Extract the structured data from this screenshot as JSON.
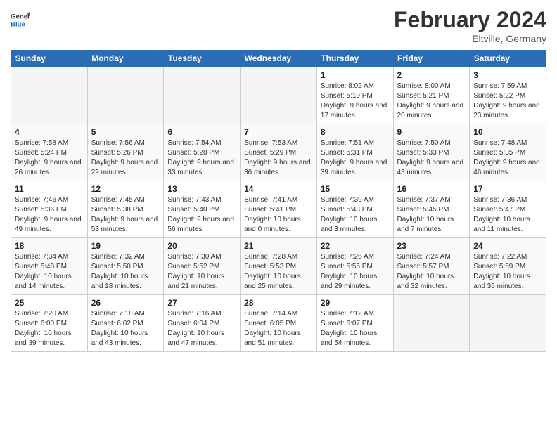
{
  "header": {
    "logo_general": "General",
    "logo_blue": "Blue",
    "month_title": "February 2024",
    "location": "Eltville, Germany"
  },
  "calendar": {
    "days_of_week": [
      "Sunday",
      "Monday",
      "Tuesday",
      "Wednesday",
      "Thursday",
      "Friday",
      "Saturday"
    ],
    "weeks": [
      [
        {
          "day": "",
          "sunrise": "",
          "sunset": "",
          "daylight": "",
          "empty": true
        },
        {
          "day": "",
          "sunrise": "",
          "sunset": "",
          "daylight": "",
          "empty": true
        },
        {
          "day": "",
          "sunrise": "",
          "sunset": "",
          "daylight": "",
          "empty": true
        },
        {
          "day": "",
          "sunrise": "",
          "sunset": "",
          "daylight": "",
          "empty": true
        },
        {
          "day": "1",
          "sunrise": "Sunrise: 8:02 AM",
          "sunset": "Sunset: 5:19 PM",
          "daylight": "Daylight: 9 hours and 17 minutes.",
          "empty": false
        },
        {
          "day": "2",
          "sunrise": "Sunrise: 8:00 AM",
          "sunset": "Sunset: 5:21 PM",
          "daylight": "Daylight: 9 hours and 20 minutes.",
          "empty": false
        },
        {
          "day": "3",
          "sunrise": "Sunrise: 7:59 AM",
          "sunset": "Sunset: 5:22 PM",
          "daylight": "Daylight: 9 hours and 23 minutes.",
          "empty": false
        }
      ],
      [
        {
          "day": "4",
          "sunrise": "Sunrise: 7:58 AM",
          "sunset": "Sunset: 5:24 PM",
          "daylight": "Daylight: 9 hours and 26 minutes.",
          "empty": false
        },
        {
          "day": "5",
          "sunrise": "Sunrise: 7:56 AM",
          "sunset": "Sunset: 5:26 PM",
          "daylight": "Daylight: 9 hours and 29 minutes.",
          "empty": false
        },
        {
          "day": "6",
          "sunrise": "Sunrise: 7:54 AM",
          "sunset": "Sunset: 5:28 PM",
          "daylight": "Daylight: 9 hours and 33 minutes.",
          "empty": false
        },
        {
          "day": "7",
          "sunrise": "Sunrise: 7:53 AM",
          "sunset": "Sunset: 5:29 PM",
          "daylight": "Daylight: 9 hours and 36 minutes.",
          "empty": false
        },
        {
          "day": "8",
          "sunrise": "Sunrise: 7:51 AM",
          "sunset": "Sunset: 5:31 PM",
          "daylight": "Daylight: 9 hours and 39 minutes.",
          "empty": false
        },
        {
          "day": "9",
          "sunrise": "Sunrise: 7:50 AM",
          "sunset": "Sunset: 5:33 PM",
          "daylight": "Daylight: 9 hours and 43 minutes.",
          "empty": false
        },
        {
          "day": "10",
          "sunrise": "Sunrise: 7:48 AM",
          "sunset": "Sunset: 5:35 PM",
          "daylight": "Daylight: 9 hours and 46 minutes.",
          "empty": false
        }
      ],
      [
        {
          "day": "11",
          "sunrise": "Sunrise: 7:46 AM",
          "sunset": "Sunset: 5:36 PM",
          "daylight": "Daylight: 9 hours and 49 minutes.",
          "empty": false
        },
        {
          "day": "12",
          "sunrise": "Sunrise: 7:45 AM",
          "sunset": "Sunset: 5:38 PM",
          "daylight": "Daylight: 9 hours and 53 minutes.",
          "empty": false
        },
        {
          "day": "13",
          "sunrise": "Sunrise: 7:43 AM",
          "sunset": "Sunset: 5:40 PM",
          "daylight": "Daylight: 9 hours and 56 minutes.",
          "empty": false
        },
        {
          "day": "14",
          "sunrise": "Sunrise: 7:41 AM",
          "sunset": "Sunset: 5:41 PM",
          "daylight": "Daylight: 10 hours and 0 minutes.",
          "empty": false
        },
        {
          "day": "15",
          "sunrise": "Sunrise: 7:39 AM",
          "sunset": "Sunset: 5:43 PM",
          "daylight": "Daylight: 10 hours and 3 minutes.",
          "empty": false
        },
        {
          "day": "16",
          "sunrise": "Sunrise: 7:37 AM",
          "sunset": "Sunset: 5:45 PM",
          "daylight": "Daylight: 10 hours and 7 minutes.",
          "empty": false
        },
        {
          "day": "17",
          "sunrise": "Sunrise: 7:36 AM",
          "sunset": "Sunset: 5:47 PM",
          "daylight": "Daylight: 10 hours and 11 minutes.",
          "empty": false
        }
      ],
      [
        {
          "day": "18",
          "sunrise": "Sunrise: 7:34 AM",
          "sunset": "Sunset: 5:48 PM",
          "daylight": "Daylight: 10 hours and 14 minutes.",
          "empty": false
        },
        {
          "day": "19",
          "sunrise": "Sunrise: 7:32 AM",
          "sunset": "Sunset: 5:50 PM",
          "daylight": "Daylight: 10 hours and 18 minutes.",
          "empty": false
        },
        {
          "day": "20",
          "sunrise": "Sunrise: 7:30 AM",
          "sunset": "Sunset: 5:52 PM",
          "daylight": "Daylight: 10 hours and 21 minutes.",
          "empty": false
        },
        {
          "day": "21",
          "sunrise": "Sunrise: 7:28 AM",
          "sunset": "Sunset: 5:53 PM",
          "daylight": "Daylight: 10 hours and 25 minutes.",
          "empty": false
        },
        {
          "day": "22",
          "sunrise": "Sunrise: 7:26 AM",
          "sunset": "Sunset: 5:55 PM",
          "daylight": "Daylight: 10 hours and 29 minutes.",
          "empty": false
        },
        {
          "day": "23",
          "sunrise": "Sunrise: 7:24 AM",
          "sunset": "Sunset: 5:57 PM",
          "daylight": "Daylight: 10 hours and 32 minutes.",
          "empty": false
        },
        {
          "day": "24",
          "sunrise": "Sunrise: 7:22 AM",
          "sunset": "Sunset: 5:59 PM",
          "daylight": "Daylight: 10 hours and 36 minutes.",
          "empty": false
        }
      ],
      [
        {
          "day": "25",
          "sunrise": "Sunrise: 7:20 AM",
          "sunset": "Sunset: 6:00 PM",
          "daylight": "Daylight: 10 hours and 39 minutes.",
          "empty": false
        },
        {
          "day": "26",
          "sunrise": "Sunrise: 7:18 AM",
          "sunset": "Sunset: 6:02 PM",
          "daylight": "Daylight: 10 hours and 43 minutes.",
          "empty": false
        },
        {
          "day": "27",
          "sunrise": "Sunrise: 7:16 AM",
          "sunset": "Sunset: 6:04 PM",
          "daylight": "Daylight: 10 hours and 47 minutes.",
          "empty": false
        },
        {
          "day": "28",
          "sunrise": "Sunrise: 7:14 AM",
          "sunset": "Sunset: 6:05 PM",
          "daylight": "Daylight: 10 hours and 51 minutes.",
          "empty": false
        },
        {
          "day": "29",
          "sunrise": "Sunrise: 7:12 AM",
          "sunset": "Sunset: 6:07 PM",
          "daylight": "Daylight: 10 hours and 54 minutes.",
          "empty": false
        },
        {
          "day": "",
          "sunrise": "",
          "sunset": "",
          "daylight": "",
          "empty": true
        },
        {
          "day": "",
          "sunrise": "",
          "sunset": "",
          "daylight": "",
          "empty": true
        }
      ]
    ]
  }
}
